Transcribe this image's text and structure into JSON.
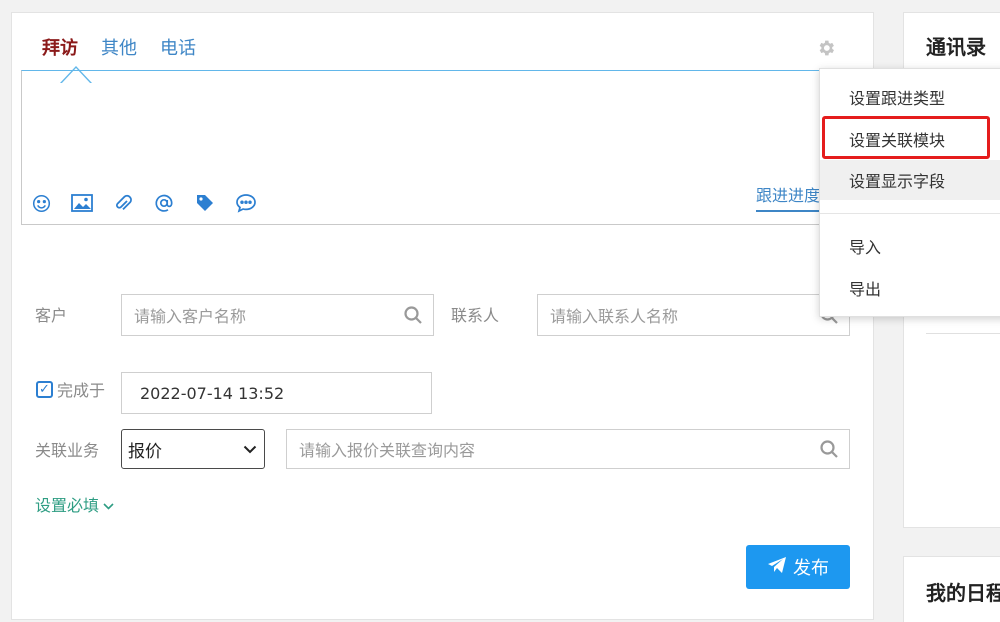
{
  "tabs": [
    {
      "label": "拜访"
    },
    {
      "label": "其他"
    },
    {
      "label": "电话"
    }
  ],
  "editor": {
    "progress_link": "跟进进度"
  },
  "form": {
    "customer_label": "客户",
    "customer_placeholder": "请输入客户名称",
    "contact_label": "联系人",
    "contact_placeholder": "请输入联系人名称",
    "completed_label": "完成于",
    "completed_value": "2022-07-14 13:52",
    "related_label": "关联业务",
    "related_select_value": "报价",
    "related_placeholder": "请输入报价关联查询内容",
    "required_link": "设置必填",
    "publish_button": "发布"
  },
  "dropdown": {
    "items": [
      {
        "label": "设置跟进类型"
      },
      {
        "label": "设置关联模块"
      },
      {
        "label": "设置显示字段"
      },
      {
        "label": "导入"
      },
      {
        "label": "导出"
      }
    ]
  },
  "sidebar": {
    "contacts_title": "通讯录",
    "schedule_title": "我的日程"
  },
  "colors": {
    "active_tab": "#8b1a1a",
    "link_blue": "#3e86c6",
    "publish_bg": "#1d98f0",
    "highlight_border": "#e51c1c",
    "required_link": "#2e9d83"
  },
  "icons": [
    "smile-icon",
    "image-icon",
    "paperclip-icon",
    "at-icon",
    "tag-icon",
    "chat-icon",
    "gear-icon",
    "search-icon",
    "checkbox-icon",
    "chevron-down-icon",
    "send-icon"
  ]
}
